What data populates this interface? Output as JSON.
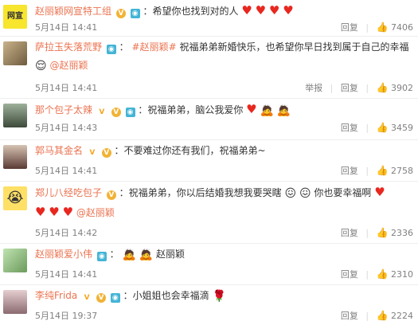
{
  "comments": [
    {
      "username": "赵丽颖网宣特工组",
      "text_before": "：希望你也找到对的人",
      "text_after": "",
      "mention": "",
      "time": "5月14日 14:41",
      "report": "",
      "reply": "回复",
      "likes": "7406",
      "badges": [
        "vip-icon",
        "camera-icon"
      ],
      "avatar_label": "网宣"
    },
    {
      "username": "萨拉玉失落荒野",
      "topic": "#赵丽颖#",
      "text_before": "祝福弟弟新婚快乐，也希望你早日找到属于自己的幸福",
      "mention": "@赵丽颖",
      "time": "5月14日 14:41",
      "report": "举报",
      "reply": "回复",
      "likes": "3902"
    },
    {
      "username": "那个包子太辣",
      "text_before": "：祝福弟弟，脑公我爱你",
      "time": "5月14日 14:43",
      "reply": "回复",
      "likes": "3459"
    },
    {
      "username": "郭马其金名",
      "text_before": "：不要难过你还有我们，祝福弟弟~",
      "time": "5月14日 14:41",
      "reply": "回复",
      "likes": "2758"
    },
    {
      "username": "郑儿八经吃包子",
      "text_before": "：祝福弟弟，你以后结婚我想我要哭瞎",
      "text_mid": "你也要幸福啊",
      "mention": "@赵丽颖",
      "time": "5月14日 14:42",
      "reply": "回复",
      "likes": "2336"
    },
    {
      "username": "赵丽颖爱小伟",
      "text_before": "赵丽颖",
      "time": "5月14日 14:41",
      "reply": "回复",
      "likes": "2310"
    },
    {
      "username": "李纯Frida",
      "text_before": "：小姐姐也会幸福滴",
      "time": "5月14日 19:37",
      "reply": "回复",
      "likes": "2224"
    }
  ]
}
